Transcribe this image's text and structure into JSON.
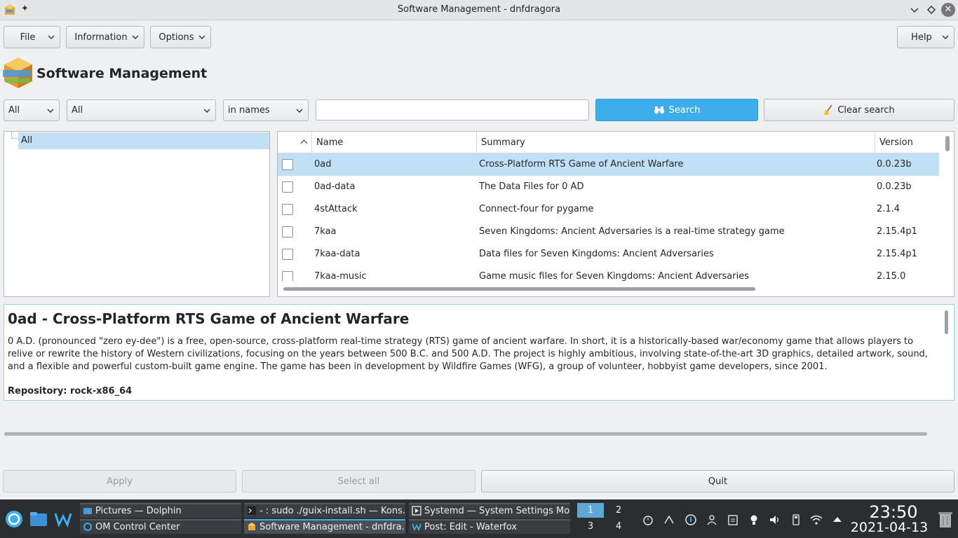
{
  "window": {
    "title": "Software Management - dnfdragora"
  },
  "menubar": {
    "file": "File",
    "information": "Information",
    "options": "Options",
    "help": "Help"
  },
  "header": {
    "title": "Software Management"
  },
  "filters": {
    "status": "All",
    "group": "All",
    "search_field": "in names",
    "search_value": "",
    "search_button": "Search",
    "clear_button": "Clear search"
  },
  "tree": {
    "items": [
      {
        "label": "All"
      }
    ]
  },
  "table": {
    "columns": [
      "Name",
      "Summary",
      "Version"
    ],
    "rows": [
      {
        "checked": false,
        "name": "0ad",
        "summary": "Cross-Platform RTS Game of Ancient Warfare",
        "version": "0.0.23b"
      },
      {
        "checked": false,
        "name": "0ad-data",
        "summary": "The Data Files for 0 AD",
        "version": "0.0.23b"
      },
      {
        "checked": false,
        "name": "4stAttack",
        "summary": "Connect-four for pygame",
        "version": "2.1.4"
      },
      {
        "checked": false,
        "name": "7kaa",
        "summary": "Seven Kingdoms: Ancient Adversaries is a real-time strategy game",
        "version": "2.15.4p1"
      },
      {
        "checked": false,
        "name": "7kaa-data",
        "summary": "Data files for Seven Kingdoms: Ancient Adversaries",
        "version": "2.15.4p1"
      },
      {
        "checked": false,
        "name": "7kaa-music",
        "summary": "Game music files for Seven Kingdoms: Ancient Adversaries",
        "version": "2.15.0"
      }
    ],
    "selected_index": 0
  },
  "description": {
    "title": "0ad - Cross-Platform RTS Game of Ancient Warfare",
    "body": "0 A.D. (pronounced \"zero ey-dee\") is a free, open-source, cross-platform real-time strategy (RTS) game of ancient warfare. In short, it is a historically-based war/economy game that allows players to relive or rewrite the history of Western civilizations, focusing on the years between 500 B.C. and 500 A.D. The project is highly ambitious, involving state-of-the-art 3D graphics, detailed artwork, sound, and a flexible and powerful custom-built game engine. The game has been in development by Wildfire Games (WFG), a group of volunteer, hobbyist game developers, since 2001.",
    "repository": "Repository: rock-x86_64"
  },
  "actions": {
    "apply": "Apply",
    "select_all": "Select all",
    "quit": "Quit"
  },
  "taskbar": {
    "tasks": [
      {
        "label": "Pictures — Dolphin",
        "icon": "folder-icon"
      },
      {
        "label": "OM Control Center",
        "icon": "control-center-icon"
      },
      {
        "label": "- : sudo ./guix-install.sh — Kons...",
        "icon": "terminal-icon"
      },
      {
        "label": "Software Management - dnfdra...",
        "icon": "dnfdragora-icon"
      },
      {
        "label": "Systemd — System Settings Mo...",
        "icon": "settings-icon"
      },
      {
        "label": "Post: Edit - Waterfox",
        "icon": "waterfox-icon"
      }
    ],
    "desktops": [
      "1",
      "2",
      "3",
      "4"
    ],
    "current_desktop": "1",
    "clock_time": "23:50",
    "clock_date": "2021-04-13"
  },
  "colors": {
    "accent": "#3daee9",
    "selection": "#c2e0f5",
    "taskbar": "#2b2e31"
  }
}
